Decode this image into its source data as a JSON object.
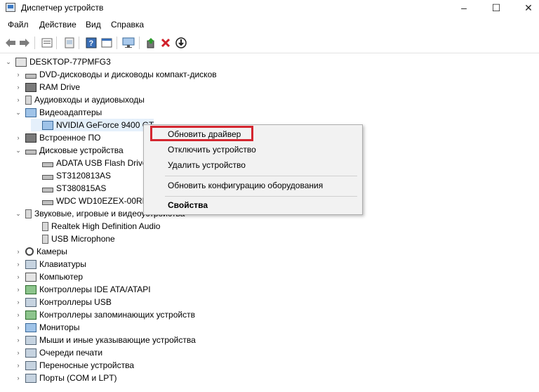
{
  "window": {
    "title": "Диспетчер устройств",
    "minimize_glyph": "–",
    "maximize_glyph": "☐",
    "close_glyph": "✕"
  },
  "menu": [
    "Файл",
    "Действие",
    "Вид",
    "Справка"
  ],
  "toolbar": {
    "icons": [
      "back-icon",
      "forward-icon",
      "properties-icon",
      "show-hidden-icon",
      "help-icon",
      "view-icon",
      "monitor-scan-icon",
      "update-driver-icon",
      "uninstall-icon",
      "enable-icon"
    ],
    "uninstall_color": "#d0202a"
  },
  "tree": {
    "root": "DESKTOP-77PMFG3",
    "items": [
      {
        "label": "DVD-дисководы и дисководы компакт-дисков",
        "icon": "dvd-drive-icon",
        "expand": "›"
      },
      {
        "label": "RAM Drive",
        "icon": "ram-drive-icon",
        "expand": "›"
      },
      {
        "label": "Аудиовходы и аудиовыходы",
        "icon": "speaker-icon",
        "expand": "›"
      },
      {
        "label": "Видеоадаптеры",
        "icon": "display-adapter-icon",
        "expand": "⌄"
      },
      {
        "label": "NVIDIA GeForce 9400 GT",
        "icon": "gpu-icon",
        "expand": ""
      },
      {
        "label": "Встроенное ПО",
        "icon": "firmware-icon",
        "expand": "›"
      },
      {
        "label": "Дисковые устройства",
        "icon": "disk-icon",
        "expand": "⌄"
      },
      {
        "label": "ADATA USB Flash Drive",
        "icon": "drive-icon",
        "expand": ""
      },
      {
        "label": "ST3120813AS",
        "icon": "drive-icon",
        "expand": ""
      },
      {
        "label": "ST380815AS",
        "icon": "drive-icon",
        "expand": ""
      },
      {
        "label": "WDC WD10EZEX-00RKK",
        "icon": "drive-icon",
        "expand": ""
      },
      {
        "label": "Звуковые, игровые и видеоустройства",
        "icon": "sound-icon",
        "expand": "⌄"
      },
      {
        "label": "Realtek High Definition Audio",
        "icon": "speaker-icon",
        "expand": ""
      },
      {
        "label": "USB Microphone",
        "icon": "speaker-icon",
        "expand": ""
      },
      {
        "label": "Камеры",
        "icon": "camera-icon",
        "expand": "›"
      },
      {
        "label": "Клавиатуры",
        "icon": "keyboard-icon",
        "expand": "›"
      },
      {
        "label": "Компьютер",
        "icon": "computer-icon",
        "expand": "›"
      },
      {
        "label": "Контроллеры IDE ATA/ATAPI",
        "icon": "ide-controller-icon",
        "expand": "›"
      },
      {
        "label": "Контроллеры USB",
        "icon": "usb-icon",
        "expand": "›"
      },
      {
        "label": "Контроллеры запоминающих устройств",
        "icon": "storage-controller-icon",
        "expand": "›"
      },
      {
        "label": "Мониторы",
        "icon": "monitor-icon",
        "expand": "›"
      },
      {
        "label": "Мыши и иные указывающие устройства",
        "icon": "mouse-icon",
        "expand": "›"
      },
      {
        "label": "Очереди печати",
        "icon": "printer-icon",
        "expand": "›"
      },
      {
        "label": "Переносные устройства",
        "icon": "portable-device-icon",
        "expand": "›"
      },
      {
        "label": "Порты (COM и LPT)",
        "icon": "port-icon",
        "expand": "›"
      }
    ]
  },
  "context_menu": {
    "update_driver": "Обновить драйвер",
    "disable_device": "Отключить устройство",
    "uninstall_device": "Удалить устройство",
    "scan_hardware": "Обновить конфигурацию оборудования",
    "properties": "Свойства",
    "highlight_color": "#d4262f"
  }
}
